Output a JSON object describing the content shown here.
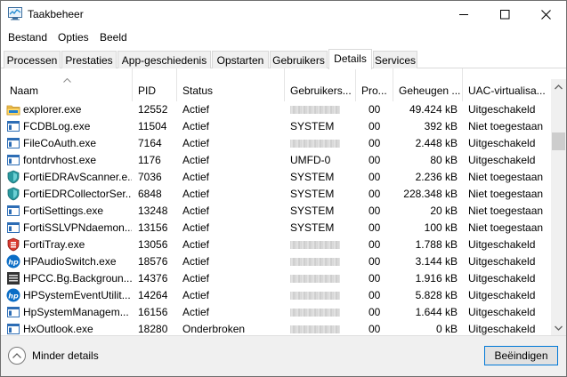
{
  "window": {
    "title": "Taakbeheer"
  },
  "menu": [
    {
      "label": "Bestand"
    },
    {
      "label": "Opties"
    },
    {
      "label": "Beeld"
    }
  ],
  "tabs": [
    {
      "label": "Processen",
      "active": false
    },
    {
      "label": "Prestaties",
      "active": false
    },
    {
      "label": "App-geschiedenis",
      "active": false
    },
    {
      "label": "Opstarten",
      "active": false
    },
    {
      "label": "Gebruikers",
      "active": false
    },
    {
      "label": "Details",
      "active": true
    },
    {
      "label": "Services",
      "active": false
    }
  ],
  "columns": [
    {
      "label": "Naam"
    },
    {
      "label": "PID"
    },
    {
      "label": "Status"
    },
    {
      "label": "Gebruikers..."
    },
    {
      "label": "Pro..."
    },
    {
      "label": "Geheugen ..."
    },
    {
      "label": "UAC-virtualisa..."
    }
  ],
  "rows": [
    {
      "icon": "folder-icon",
      "name": "explorer.exe",
      "pid": "12552",
      "status": "Actief",
      "user": "",
      "user_blurred": true,
      "cpu": "00",
      "memory": "49.424 kB",
      "uac": "Uitgeschakeld"
    },
    {
      "icon": "window-app-icon",
      "name": "FCDBLog.exe",
      "pid": "11504",
      "status": "Actief",
      "user": "SYSTEM",
      "user_blurred": false,
      "cpu": "00",
      "memory": "392 kB",
      "uac": "Niet toegestaan"
    },
    {
      "icon": "window-app-icon",
      "name": "FileCoAuth.exe",
      "pid": "7164",
      "status": "Actief",
      "user": "",
      "user_blurred": true,
      "cpu": "00",
      "memory": "2.448 kB",
      "uac": "Uitgeschakeld"
    },
    {
      "icon": "window-app-icon",
      "name": "fontdrvhost.exe",
      "pid": "1176",
      "status": "Actief",
      "user": "UMFD-0",
      "user_blurred": false,
      "cpu": "00",
      "memory": "80 kB",
      "uac": "Uitgeschakeld"
    },
    {
      "icon": "shield-app-icon",
      "name": "FortiEDRAvScanner.e...",
      "pid": "7036",
      "status": "Actief",
      "user": "SYSTEM",
      "user_blurred": false,
      "cpu": "00",
      "memory": "2.236 kB",
      "uac": "Niet toegestaan"
    },
    {
      "icon": "shield-app-icon",
      "name": "FortiEDRCollectorSer...",
      "pid": "6848",
      "status": "Actief",
      "user": "SYSTEM",
      "user_blurred": false,
      "cpu": "00",
      "memory": "228.348 kB",
      "uac": "Niet toegestaan"
    },
    {
      "icon": "window-app-icon",
      "name": "FortiSettings.exe",
      "pid": "13248",
      "status": "Actief",
      "user": "SYSTEM",
      "user_blurred": false,
      "cpu": "00",
      "memory": "20 kB",
      "uac": "Niet toegestaan"
    },
    {
      "icon": "window-app-icon",
      "name": "FortiSSLVPNdaemon...",
      "pid": "13156",
      "status": "Actief",
      "user": "SYSTEM",
      "user_blurred": false,
      "cpu": "00",
      "memory": "100 kB",
      "uac": "Niet toegestaan"
    },
    {
      "icon": "forti-tray-icon",
      "name": "FortiTray.exe",
      "pid": "13056",
      "status": "Actief",
      "user": "",
      "user_blurred": true,
      "cpu": "00",
      "memory": "1.788 kB",
      "uac": "Uitgeschakeld"
    },
    {
      "icon": "hp-logo-icon",
      "name": "HPAudioSwitch.exe",
      "pid": "18576",
      "status": "Actief",
      "user": "",
      "user_blurred": true,
      "cpu": "00",
      "memory": "3.144 kB",
      "uac": "Uitgeschakeld"
    },
    {
      "icon": "dark-app-icon",
      "name": "HPCC.Bg.Backgroun...",
      "pid": "14376",
      "status": "Actief",
      "user": "",
      "user_blurred": true,
      "cpu": "00",
      "memory": "1.916 kB",
      "uac": "Uitgeschakeld"
    },
    {
      "icon": "hp-logo-icon",
      "name": "HPSystemEventUtilit...",
      "pid": "14264",
      "status": "Actief",
      "user": "",
      "user_blurred": true,
      "cpu": "00",
      "memory": "5.828 kB",
      "uac": "Uitgeschakeld"
    },
    {
      "icon": "window-app-icon",
      "name": "HpSystemManagem...",
      "pid": "16156",
      "status": "Actief",
      "user": "",
      "user_blurred": true,
      "cpu": "00",
      "memory": "1.644 kB",
      "uac": "Uitgeschakeld"
    },
    {
      "icon": "window-app-icon",
      "name": "HxOutlook.exe",
      "pid": "18280",
      "status": "Onderbroken",
      "user": "",
      "user_blurred": true,
      "cpu": "00",
      "memory": "0 kB",
      "uac": "Uitgeschakeld"
    }
  ],
  "footer": {
    "less_details": "Minder details",
    "end_task": "Beëindigen"
  }
}
